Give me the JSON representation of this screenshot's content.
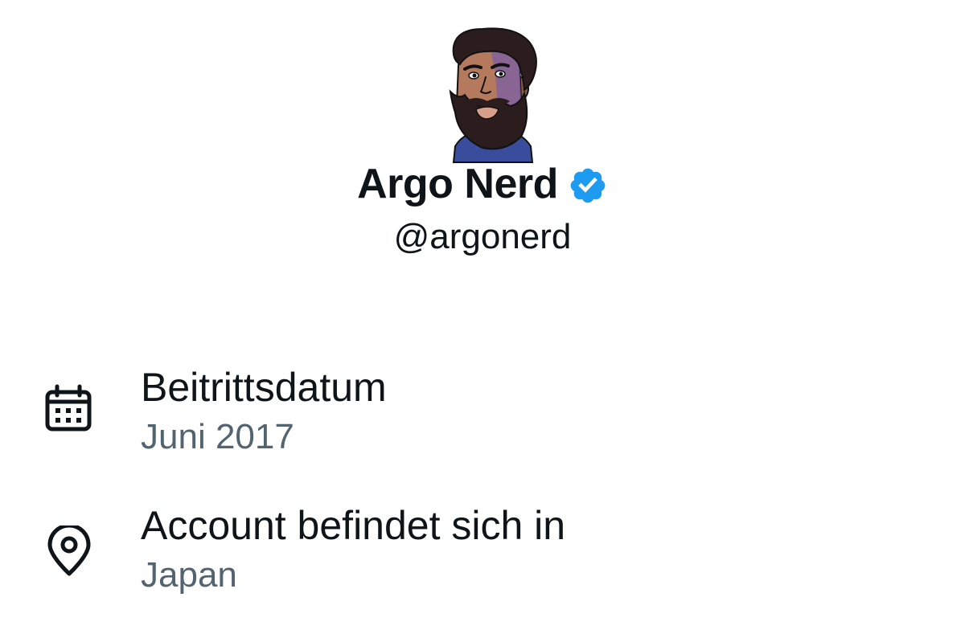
{
  "profile": {
    "display_name": "Argo Nerd",
    "handle": "@argonerd",
    "verified": true,
    "avatar": "bearded-man-illustration"
  },
  "about": {
    "joined": {
      "icon": "calendar-icon",
      "title": "Beitrittsdatum",
      "value": "Juni 2017"
    },
    "location": {
      "icon": "location-pin-icon",
      "title": "Account befindet sich in",
      "value": "Japan"
    }
  },
  "colors": {
    "text_primary": "#0f1419",
    "text_secondary": "#536471",
    "verified_blue": "#1d9bf0",
    "background": "#ffffff"
  }
}
